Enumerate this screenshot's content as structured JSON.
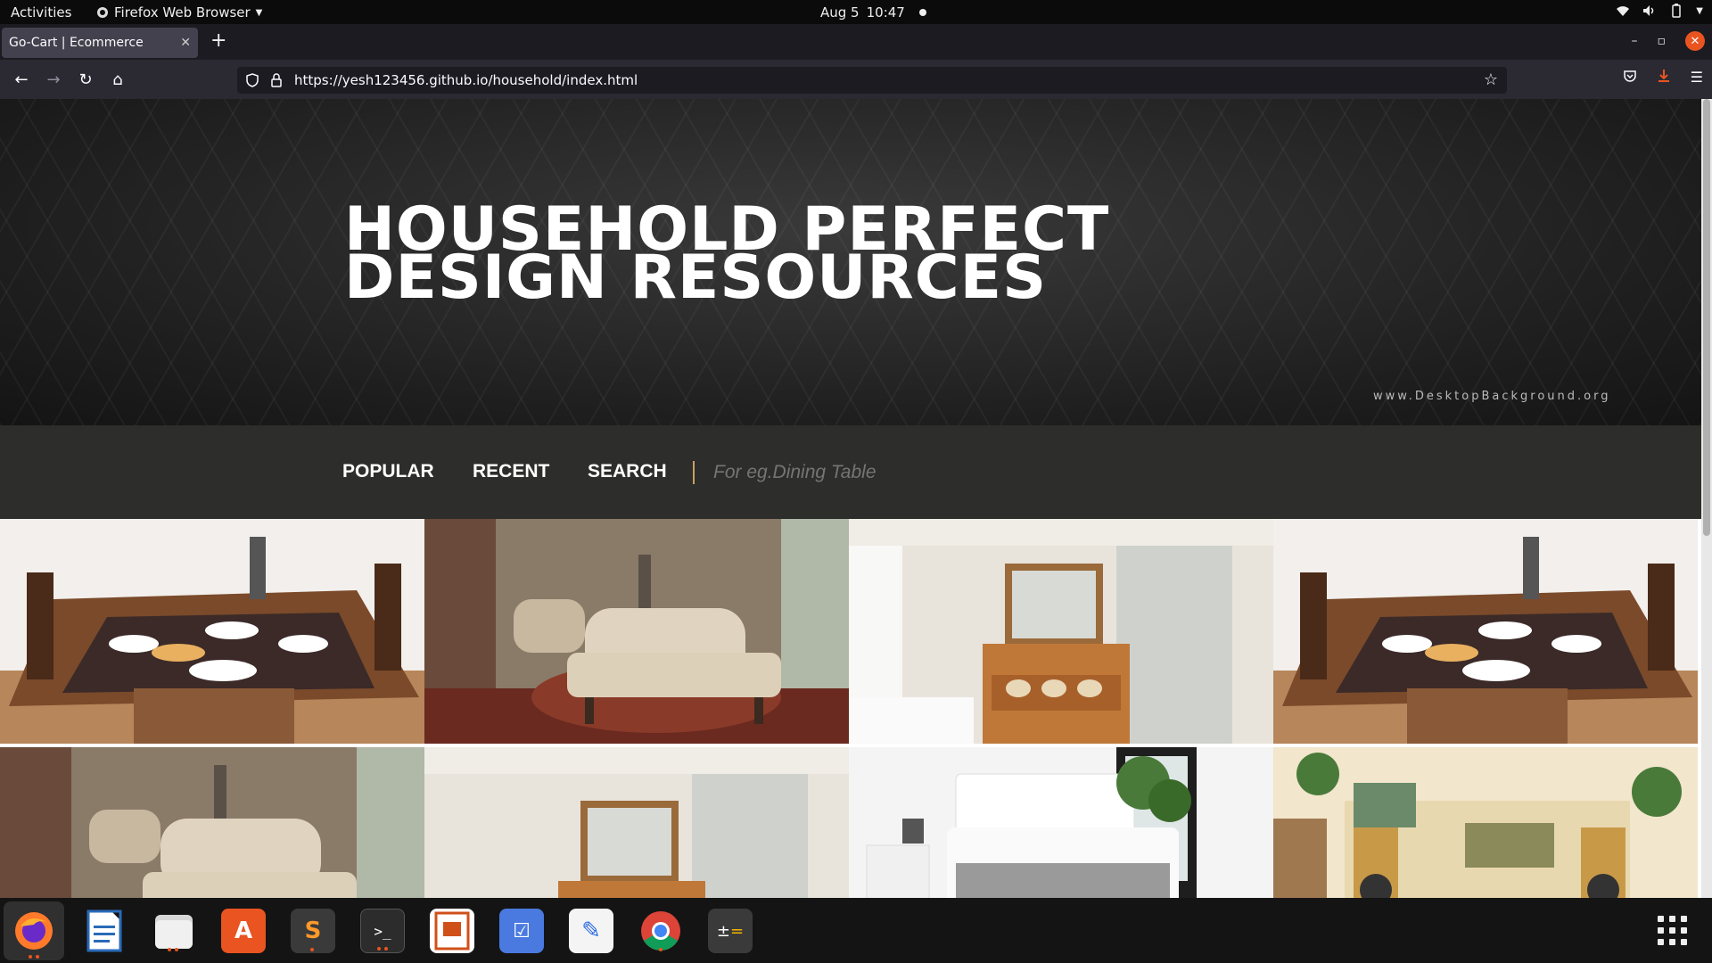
{
  "system": {
    "activities": "Activities",
    "app_menu": "Firefox Web Browser",
    "date": "Aug 5",
    "time": "10:47"
  },
  "browser": {
    "tab_title": "Go-Cart | Ecommerce",
    "url": "https://yesh123456.github.io/household/index.html"
  },
  "hero": {
    "title_line1": "HOUSEHOLD PERFECT",
    "title_line2": "DESIGN RESOURCES",
    "watermark": "www.DesktopBackground.org"
  },
  "menu": {
    "items": [
      "POPULAR",
      "RECENT",
      "SEARCH"
    ],
    "search_placeholder": "For eg.Dining Table",
    "divider_color": "#c8a060"
  },
  "gallery": {
    "tiles": [
      {
        "subject": "dining-table"
      },
      {
        "subject": "armchair"
      },
      {
        "subject": "bathroom-vanity"
      },
      {
        "subject": "dining-table"
      },
      {
        "subject": "armchair"
      },
      {
        "subject": "bathroom-vanity"
      },
      {
        "subject": "bedroom"
      },
      {
        "subject": "living-room-shelf"
      }
    ]
  },
  "dock": {
    "apps": [
      "firefox-icon",
      "writer-icon",
      "files-icon",
      "software-icon",
      "sublime-icon",
      "terminal-icon",
      "impress-icon",
      "tasks-icon",
      "editor-icon",
      "chrome-icon",
      "calculator-icon"
    ]
  },
  "colors": {
    "accent_orange": "#e95420",
    "menu_bg": "#2d2d2b"
  }
}
